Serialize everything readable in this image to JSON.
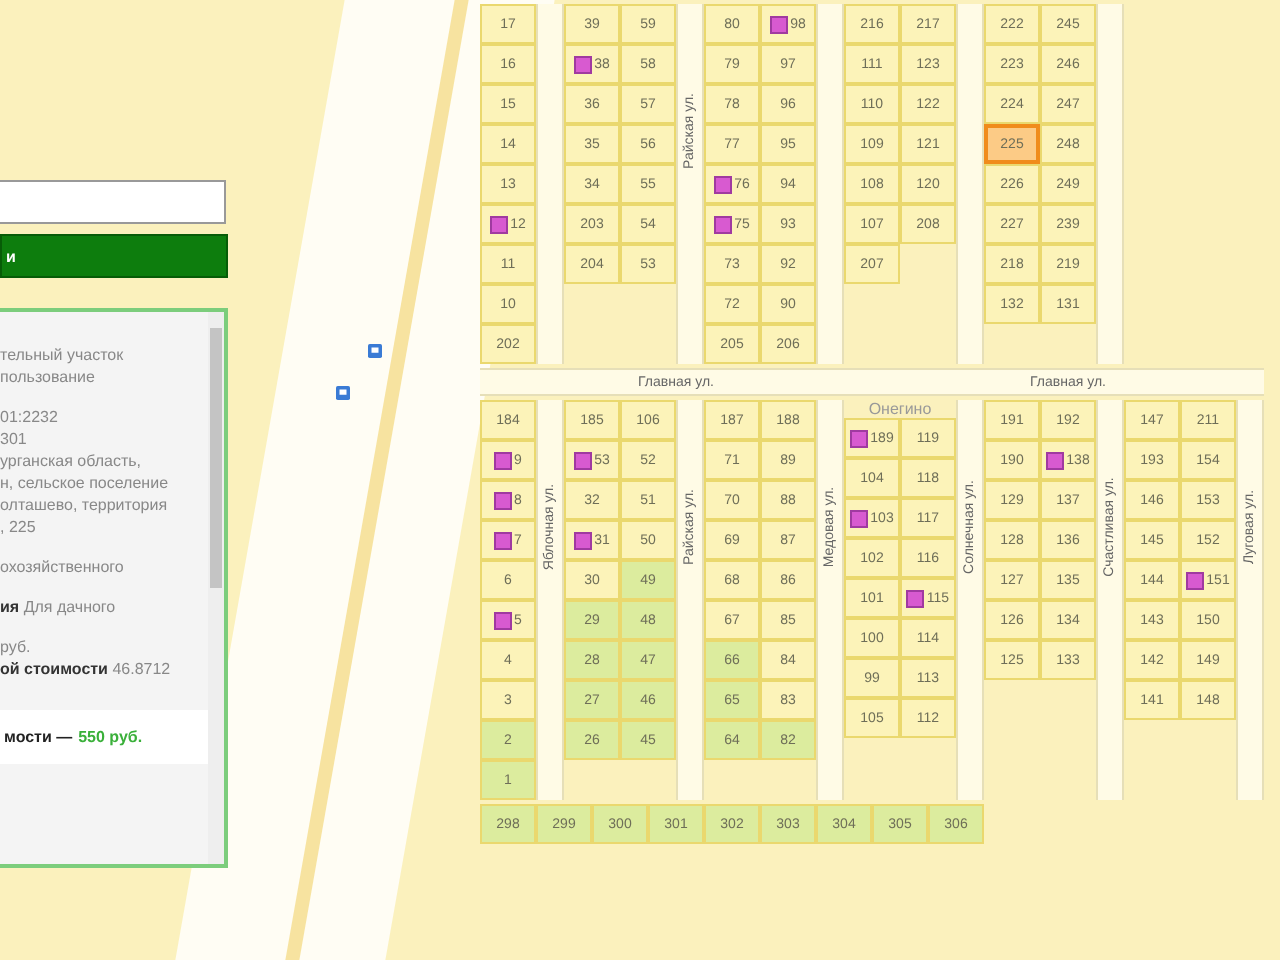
{
  "search_button": {
    "label": "и"
  },
  "info_panel": {
    "sections": [
      [
        "тельный участок",
        "пользование"
      ],
      [
        "01:2232",
        "301",
        "урганская область,",
        "н, сельское поселение",
        "олташево, территория",
        ", 225"
      ],
      [
        "охозяйственного"
      ],
      [
        "**ия** Для дачного"
      ],
      [
        "руб.",
        "**ой стоимости** 46.8712"
      ]
    ],
    "footer_label": "мости —",
    "footer_price": "550 руб."
  },
  "map": {
    "upper": [
      {
        "kind": "single",
        "lots": [
          {
            "number": "17",
            "house": false,
            "selected": false,
            "wooded": false
          },
          {
            "number": "16",
            "house": false,
            "selected": false,
            "wooded": false
          },
          {
            "number": "15",
            "house": false,
            "selected": false,
            "wooded": false
          },
          {
            "number": "14",
            "house": false,
            "selected": false,
            "wooded": false
          },
          {
            "number": "13",
            "house": false,
            "selected": false,
            "wooded": false
          },
          {
            "number": "12",
            "house": true,
            "selected": false,
            "wooded": false
          },
          {
            "number": "11",
            "house": false,
            "selected": false,
            "wooded": false
          },
          {
            "number": "10",
            "house": false,
            "selected": false,
            "wooded": false
          },
          {
            "number": "202",
            "house": false,
            "selected": false,
            "wooded": false
          }
        ]
      },
      {
        "kind": "double",
        "street": "Райская ул.",
        "lots": [
          {
            "number": "39",
            "house": false,
            "selected": false,
            "wooded": false
          },
          {
            "number": "59",
            "house": false,
            "selected": false,
            "wooded": false
          },
          {
            "number": "38",
            "house": true,
            "selected": false,
            "wooded": false
          },
          {
            "number": "58",
            "house": false,
            "selected": false,
            "wooded": false
          },
          {
            "number": "36",
            "house": false,
            "selected": false,
            "wooded": false
          },
          {
            "number": "57",
            "house": false,
            "selected": false,
            "wooded": false
          },
          {
            "number": "35",
            "house": false,
            "selected": false,
            "wooded": false
          },
          {
            "number": "56",
            "house": false,
            "selected": false,
            "wooded": false
          },
          {
            "number": "34",
            "house": false,
            "selected": false,
            "wooded": false
          },
          {
            "number": "55",
            "house": false,
            "selected": false,
            "wooded": false
          },
          {
            "number": "203",
            "house": false,
            "selected": false,
            "wooded": false
          },
          {
            "number": "54",
            "house": false,
            "selected": false,
            "wooded": false
          },
          {
            "number": "204",
            "house": false,
            "selected": false,
            "wooded": false
          },
          {
            "number": "53",
            "house": false,
            "selected": false,
            "wooded": false
          }
        ]
      },
      {
        "kind": "double",
        "lots": [
          {
            "number": "80",
            "house": false,
            "selected": false,
            "wooded": false
          },
          {
            "number": "98",
            "house": true,
            "selected": false,
            "wooded": false
          },
          {
            "number": "79",
            "house": false,
            "selected": false,
            "wooded": false
          },
          {
            "number": "97",
            "house": false,
            "selected": false,
            "wooded": false
          },
          {
            "number": "78",
            "house": false,
            "selected": false,
            "wooded": false
          },
          {
            "number": "96",
            "house": false,
            "selected": false,
            "wooded": false
          },
          {
            "number": "77",
            "house": false,
            "selected": false,
            "wooded": false
          },
          {
            "number": "95",
            "house": false,
            "selected": false,
            "wooded": false
          },
          {
            "number": "76",
            "house": true,
            "selected": false,
            "wooded": false
          },
          {
            "number": "94",
            "house": false,
            "selected": false,
            "wooded": false
          },
          {
            "number": "75",
            "house": true,
            "selected": false,
            "wooded": false
          },
          {
            "number": "93",
            "house": false,
            "selected": false,
            "wooded": false
          },
          {
            "number": "73",
            "house": false,
            "selected": false,
            "wooded": false
          },
          {
            "number": "92",
            "house": false,
            "selected": false,
            "wooded": false
          },
          {
            "number": "72",
            "house": false,
            "selected": false,
            "wooded": false
          },
          {
            "number": "90",
            "house": false,
            "selected": false,
            "wooded": false
          },
          {
            "number": "205",
            "house": false,
            "selected": false,
            "wooded": false
          },
          {
            "number": "206",
            "house": false,
            "selected": false,
            "wooded": false
          }
        ]
      },
      {
        "kind": "double",
        "lots": [
          {
            "number": "216",
            "house": false,
            "selected": false,
            "wooded": false
          },
          {
            "number": "217",
            "house": false,
            "selected": false,
            "wooded": false
          },
          {
            "number": "111",
            "house": false,
            "selected": false,
            "wooded": false
          },
          {
            "number": "123",
            "house": false,
            "selected": false,
            "wooded": false
          },
          {
            "number": "110",
            "house": false,
            "selected": false,
            "wooded": false
          },
          {
            "number": "122",
            "house": false,
            "selected": false,
            "wooded": false
          },
          {
            "number": "109",
            "house": false,
            "selected": false,
            "wooded": false
          },
          {
            "number": "121",
            "house": false,
            "selected": false,
            "wooded": false
          },
          {
            "number": "108",
            "house": false,
            "selected": false,
            "wooded": false
          },
          {
            "number": "120",
            "house": false,
            "selected": false,
            "wooded": false
          },
          {
            "number": "107",
            "house": false,
            "selected": false,
            "wooded": false
          },
          {
            "number": "208",
            "house": false,
            "selected": false,
            "wooded": false
          },
          {
            "number": "207",
            "house": false,
            "selected": false,
            "wooded": false
          }
        ]
      },
      {
        "kind": "double",
        "lots": [
          {
            "number": "222",
            "house": false,
            "selected": false,
            "wooded": false
          },
          {
            "number": "245",
            "house": false,
            "selected": false,
            "wooded": false
          },
          {
            "number": "223",
            "house": false,
            "selected": false,
            "wooded": false
          },
          {
            "number": "246",
            "house": false,
            "selected": false,
            "wooded": false
          },
          {
            "number": "224",
            "house": false,
            "selected": false,
            "wooded": false
          },
          {
            "number": "247",
            "house": false,
            "selected": false,
            "wooded": false
          },
          {
            "number": "225",
            "house": false,
            "selected": true,
            "wooded": false
          },
          {
            "number": "248",
            "house": false,
            "selected": false,
            "wooded": false
          },
          {
            "number": "226",
            "house": false,
            "selected": false,
            "wooded": false
          },
          {
            "number": "249",
            "house": false,
            "selected": false,
            "wooded": false
          },
          {
            "number": "227",
            "house": false,
            "selected": false,
            "wooded": false
          },
          {
            "number": "239",
            "house": false,
            "selected": false,
            "wooded": false
          },
          {
            "number": "218",
            "house": false,
            "selected": false,
            "wooded": false
          },
          {
            "number": "219",
            "house": false,
            "selected": false,
            "wooded": false
          },
          {
            "number": "132",
            "house": false,
            "selected": false,
            "wooded": false
          },
          {
            "number": "131",
            "house": false,
            "selected": false,
            "wooded": false
          }
        ]
      }
    ],
    "main_street_labels": [
      "Главная ул.",
      "Главная ул."
    ],
    "lower": [
      {
        "kind": "single",
        "street": "Яблочная ул.",
        "lots": [
          {
            "number": "184",
            "house": false,
            "selected": false,
            "wooded": false
          },
          {
            "number": "9",
            "house": true,
            "selected": false,
            "wooded": false
          },
          {
            "number": "8",
            "house": true,
            "selected": false,
            "wooded": false
          },
          {
            "number": "7",
            "house": true,
            "selected": false,
            "wooded": false
          },
          {
            "number": "6",
            "house": false,
            "selected": false,
            "wooded": false
          },
          {
            "number": "5",
            "house": true,
            "selected": false,
            "wooded": false
          },
          {
            "number": "4",
            "house": false,
            "selected": false,
            "wooded": false
          },
          {
            "number": "3",
            "house": false,
            "selected": false,
            "wooded": false
          },
          {
            "number": "2",
            "house": false,
            "selected": false,
            "wooded": true
          },
          {
            "number": "1",
            "house": false,
            "selected": false,
            "wooded": true
          }
        ]
      },
      {
        "kind": "double",
        "street": "Райская ул.",
        "lots": [
          {
            "number": "185",
            "house": false,
            "selected": false,
            "wooded": false
          },
          {
            "number": "106",
            "house": false,
            "selected": false,
            "wooded": false
          },
          {
            "number": "53",
            "house": true,
            "selected": false,
            "wooded": false
          },
          {
            "number": "52",
            "house": false,
            "selected": false,
            "wooded": false
          },
          {
            "number": "32",
            "house": false,
            "selected": false,
            "wooded": false
          },
          {
            "number": "51",
            "house": false,
            "selected": false,
            "wooded": false
          },
          {
            "number": "31",
            "house": true,
            "selected": false,
            "wooded": false
          },
          {
            "number": "50",
            "house": false,
            "selected": false,
            "wooded": false
          },
          {
            "number": "30",
            "house": false,
            "selected": false,
            "wooded": false
          },
          {
            "number": "49",
            "house": false,
            "selected": false,
            "wooded": true
          },
          {
            "number": "29",
            "house": false,
            "selected": false,
            "wooded": true
          },
          {
            "number": "48",
            "house": false,
            "selected": false,
            "wooded": true
          },
          {
            "number": "28",
            "house": false,
            "selected": false,
            "wooded": true
          },
          {
            "number": "47",
            "house": false,
            "selected": false,
            "wooded": true
          },
          {
            "number": "27",
            "house": false,
            "selected": false,
            "wooded": true
          },
          {
            "number": "46",
            "house": false,
            "selected": false,
            "wooded": true
          },
          {
            "number": "26",
            "house": false,
            "selected": false,
            "wooded": true
          },
          {
            "number": "45",
            "house": false,
            "selected": false,
            "wooded": true
          }
        ]
      },
      {
        "kind": "double",
        "street": "Медовая ул.",
        "lots": [
          {
            "number": "187",
            "house": false,
            "selected": false,
            "wooded": false
          },
          {
            "number": "188",
            "house": false,
            "selected": false,
            "wooded": false
          },
          {
            "number": "71",
            "house": false,
            "selected": false,
            "wooded": false
          },
          {
            "number": "89",
            "house": false,
            "selected": false,
            "wooded": false
          },
          {
            "number": "70",
            "house": false,
            "selected": false,
            "wooded": false
          },
          {
            "number": "88",
            "house": false,
            "selected": false,
            "wooded": false
          },
          {
            "number": "69",
            "house": false,
            "selected": false,
            "wooded": false
          },
          {
            "number": "87",
            "house": false,
            "selected": false,
            "wooded": false
          },
          {
            "number": "68",
            "house": false,
            "selected": false,
            "wooded": false
          },
          {
            "number": "86",
            "house": false,
            "selected": false,
            "wooded": false
          },
          {
            "number": "67",
            "house": false,
            "selected": false,
            "wooded": false
          },
          {
            "number": "85",
            "house": false,
            "selected": false,
            "wooded": false
          },
          {
            "number": "66",
            "house": false,
            "selected": false,
            "wooded": true
          },
          {
            "number": "84",
            "house": false,
            "selected": false,
            "wooded": false
          },
          {
            "number": "65",
            "house": false,
            "selected": false,
            "wooded": true
          },
          {
            "number": "83",
            "house": false,
            "selected": false,
            "wooded": false
          },
          {
            "number": "64",
            "house": false,
            "selected": false,
            "wooded": true
          },
          {
            "number": "82",
            "house": false,
            "selected": false,
            "wooded": true
          }
        ]
      },
      {
        "kind": "double",
        "street": "Солнечная ул.",
        "place": "Онегино",
        "lots": [
          {
            "number": "189",
            "house": true,
            "selected": false,
            "wooded": false
          },
          {
            "number": "119",
            "house": false,
            "selected": false,
            "wooded": false
          },
          {
            "number": "104",
            "house": false,
            "selected": false,
            "wooded": false
          },
          {
            "number": "118",
            "house": false,
            "selected": false,
            "wooded": false
          },
          {
            "number": "103",
            "house": true,
            "selected": false,
            "wooded": false
          },
          {
            "number": "117",
            "house": false,
            "selected": false,
            "wooded": false
          },
          {
            "number": "102",
            "house": false,
            "selected": false,
            "wooded": false
          },
          {
            "number": "116",
            "house": false,
            "selected": false,
            "wooded": false
          },
          {
            "number": "101",
            "house": false,
            "selected": false,
            "wooded": false
          },
          {
            "number": "115",
            "house": true,
            "selected": false,
            "wooded": false
          },
          {
            "number": "100",
            "house": false,
            "selected": false,
            "wooded": false
          },
          {
            "number": "114",
            "house": false,
            "selected": false,
            "wooded": false
          },
          {
            "number": "99",
            "house": false,
            "selected": false,
            "wooded": false
          },
          {
            "number": "113",
            "house": false,
            "selected": false,
            "wooded": false
          },
          {
            "number": "105",
            "house": false,
            "selected": false,
            "wooded": false
          },
          {
            "number": "112",
            "house": false,
            "selected": false,
            "wooded": false
          }
        ]
      },
      {
        "kind": "double",
        "street": "Счастливая ул.",
        "lots": [
          {
            "number": "191",
            "house": false,
            "selected": false,
            "wooded": false
          },
          {
            "number": "192",
            "house": false,
            "selected": false,
            "wooded": false
          },
          {
            "number": "190",
            "house": false,
            "selected": false,
            "wooded": false
          },
          {
            "number": "138",
            "house": true,
            "selected": false,
            "wooded": false
          },
          {
            "number": "129",
            "house": false,
            "selected": false,
            "wooded": false
          },
          {
            "number": "137",
            "house": false,
            "selected": false,
            "wooded": false
          },
          {
            "number": "128",
            "house": false,
            "selected": false,
            "wooded": false
          },
          {
            "number": "136",
            "house": false,
            "selected": false,
            "wooded": false
          },
          {
            "number": "127",
            "house": false,
            "selected": false,
            "wooded": false
          },
          {
            "number": "135",
            "house": false,
            "selected": false,
            "wooded": false
          },
          {
            "number": "126",
            "house": false,
            "selected": false,
            "wooded": false
          },
          {
            "number": "134",
            "house": false,
            "selected": false,
            "wooded": false
          },
          {
            "number": "125",
            "house": false,
            "selected": false,
            "wooded": false
          },
          {
            "number": "133",
            "house": false,
            "selected": false,
            "wooded": false
          }
        ]
      },
      {
        "kind": "double",
        "street": "Луговая ул.",
        "lots": [
          {
            "number": "147",
            "house": false,
            "selected": false,
            "wooded": false
          },
          {
            "number": "211",
            "house": false,
            "selected": false,
            "wooded": false
          },
          {
            "number": "193",
            "house": false,
            "selected": false,
            "wooded": false
          },
          {
            "number": "154",
            "house": false,
            "selected": false,
            "wooded": false
          },
          {
            "number": "146",
            "house": false,
            "selected": false,
            "wooded": false
          },
          {
            "number": "153",
            "house": false,
            "selected": false,
            "wooded": false
          },
          {
            "number": "145",
            "house": false,
            "selected": false,
            "wooded": false
          },
          {
            "number": "152",
            "house": false,
            "selected": false,
            "wooded": false
          },
          {
            "number": "144",
            "house": false,
            "selected": false,
            "wooded": false
          },
          {
            "number": "151",
            "house": true,
            "selected": false,
            "wooded": false
          },
          {
            "number": "143",
            "house": false,
            "selected": false,
            "wooded": false
          },
          {
            "number": "150",
            "house": false,
            "selected": false,
            "wooded": false
          },
          {
            "number": "142",
            "house": false,
            "selected": false,
            "wooded": false
          },
          {
            "number": "149",
            "house": false,
            "selected": false,
            "wooded": false
          },
          {
            "number": "141",
            "house": false,
            "selected": false,
            "wooded": false
          },
          {
            "number": "148",
            "house": false,
            "selected": false,
            "wooded": false
          }
        ]
      }
    ],
    "bottom": {
      "kind": "strip",
      "lots": [
        {
          "number": "298",
          "house": false,
          "selected": false,
          "wooded": true
        },
        {
          "number": "299",
          "house": false,
          "selected": false,
          "wooded": true
        },
        {
          "number": "300",
          "house": false,
          "selected": false,
          "wooded": true
        },
        {
          "number": "301",
          "house": false,
          "selected": false,
          "wooded": true
        },
        {
          "number": "302",
          "house": false,
          "selected": false,
          "wooded": true
        },
        {
          "number": "303",
          "house": false,
          "selected": false,
          "wooded": true
        },
        {
          "number": "304",
          "house": false,
          "selected": false,
          "wooded": true
        },
        {
          "number": "305",
          "house": false,
          "selected": false,
          "wooded": true
        },
        {
          "number": "306",
          "house": false,
          "selected": false,
          "wooded": true
        }
      ]
    }
  }
}
